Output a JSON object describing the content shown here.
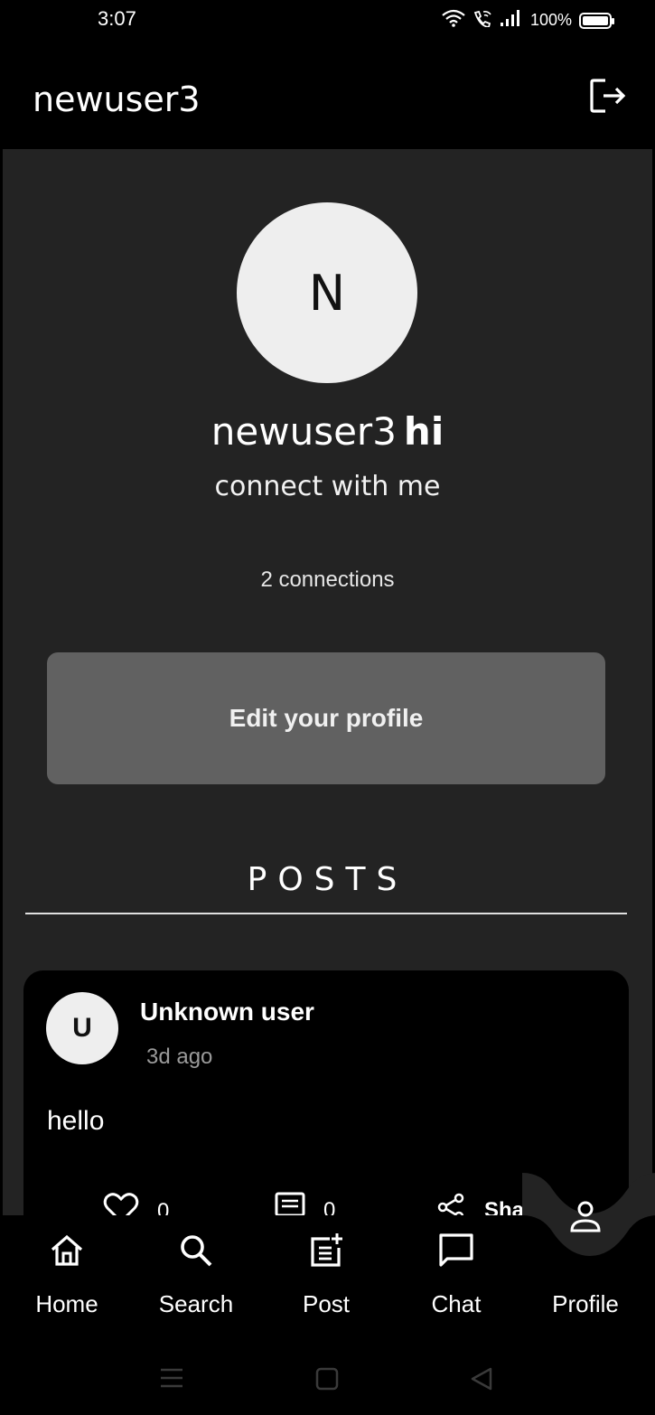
{
  "status_bar": {
    "time": "3:07",
    "battery": "100%",
    "battery_level": 1.0,
    "icons": [
      "wifi-icon",
      "wifi-call-icon",
      "signal-icon",
      "battery-icon"
    ]
  },
  "app_bar": {
    "title": "newuser3",
    "logout_icon": "logout-icon"
  },
  "profile": {
    "avatar_letter": "N",
    "name": "newuser3",
    "nickname": "hi",
    "bio": "connect with me",
    "connections": "2 connections",
    "edit_button": "Edit your profile"
  },
  "posts": {
    "heading": "POSTS",
    "items": [
      {
        "avatar_letter": "U",
        "author": "Unknown user",
        "time": "3d ago",
        "body": "hello",
        "likes": "0",
        "comments": "0",
        "share_label": "Share"
      }
    ]
  },
  "bottom_nav": {
    "items": [
      {
        "label": "Home",
        "icon": "home-icon"
      },
      {
        "label": "Search",
        "icon": "search-icon"
      },
      {
        "label": "Post",
        "icon": "post-add-icon"
      },
      {
        "label": "Chat",
        "icon": "chat-icon"
      },
      {
        "label": "Profile",
        "icon": "person-icon",
        "active": true
      }
    ]
  },
  "colors": {
    "background": "#000000",
    "surface": "#232323",
    "button": "#616161",
    "avatar": "#eeeeee",
    "muted_text": "#9a9a9a"
  }
}
